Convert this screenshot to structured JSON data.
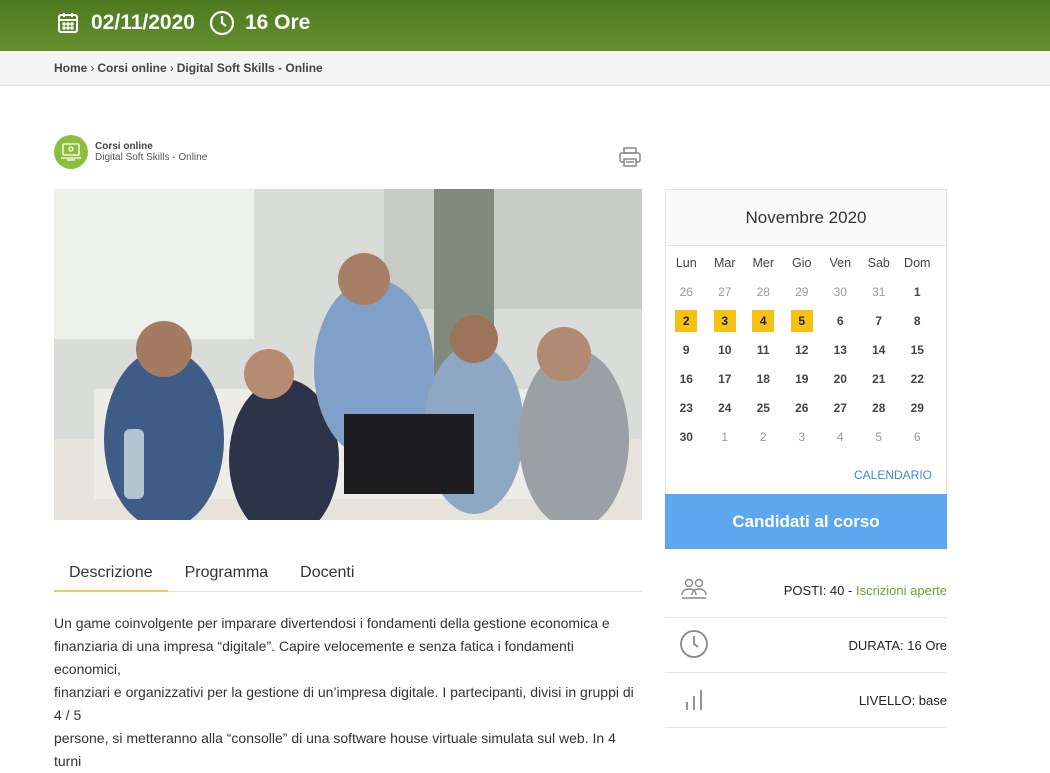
{
  "topbar": {
    "date": "02/11/2020",
    "duration": "16 Ore",
    "bg": "#5a8a28"
  },
  "breadcrumb": {
    "home": "Home",
    "category": "Corsi online",
    "current": "Digital Soft Skills - Online"
  },
  "category": {
    "name": "Corsi online",
    "course": "Digital Soft Skills - Online"
  },
  "tabs": [
    {
      "label": "Descrizione"
    },
    {
      "label": "Programma"
    },
    {
      "label": "Docenti"
    }
  ],
  "description": {
    "line1": "Un game coinvolgente per imparare divertendosi i fondamenti della gestione economica e",
    "line2": "finanziaria di una impresa “digitale”. Capire velocemente e senza fatica i fondamenti economici,",
    "line3": "finanziari e organizzativi per la gestione di un’impresa digitale. I partecipanti, divisi in gruppi di 4 / 5",
    "line4": "persone, si metteranno alla “consolle” di una software house virtuale simulata sul web. In 4 turni"
  },
  "calendar": {
    "month": "Novembre 2020",
    "weekdays": [
      "Lun",
      "Mar",
      "Mer",
      "Gio",
      "Ven",
      "Sab",
      "Dom"
    ],
    "weeks": [
      [
        {
          "d": "26",
          "m": true
        },
        {
          "d": "27",
          "m": true
        },
        {
          "d": "28",
          "m": true
        },
        {
          "d": "29",
          "m": true
        },
        {
          "d": "30",
          "m": true
        },
        {
          "d": "31",
          "m": true
        },
        {
          "d": "1"
        }
      ],
      [
        {
          "d": "2",
          "h": true
        },
        {
          "d": "3",
          "h": true
        },
        {
          "d": "4",
          "h": true
        },
        {
          "d": "5",
          "h": true
        },
        {
          "d": "6"
        },
        {
          "d": "7"
        },
        {
          "d": "8"
        }
      ],
      [
        {
          "d": "9"
        },
        {
          "d": "10"
        },
        {
          "d": "11"
        },
        {
          "d": "12"
        },
        {
          "d": "13"
        },
        {
          "d": "14"
        },
        {
          "d": "15"
        }
      ],
      [
        {
          "d": "16"
        },
        {
          "d": "17"
        },
        {
          "d": "18"
        },
        {
          "d": "19"
        },
        {
          "d": "20"
        },
        {
          "d": "21"
        },
        {
          "d": "22"
        }
      ],
      [
        {
          "d": "23"
        },
        {
          "d": "24"
        },
        {
          "d": "25"
        },
        {
          "d": "26"
        },
        {
          "d": "27"
        },
        {
          "d": "28"
        },
        {
          "d": "29"
        }
      ],
      [
        {
          "d": "30"
        },
        {
          "d": "1",
          "m": true
        },
        {
          "d": "2",
          "m": true
        },
        {
          "d": "3",
          "m": true
        },
        {
          "d": "4",
          "m": true
        },
        {
          "d": "5",
          "m": true
        },
        {
          "d": "6",
          "m": true
        }
      ]
    ],
    "link": "CALENDARIO",
    "highlight_color": "#f5c213"
  },
  "apply_label": "Candidati al corso",
  "info": {
    "posti_label": "POSTI: 40 -",
    "posti_status": "Iscrizioni aperte",
    "durata": "DURATA: 16 Ore",
    "livello": "LIVELLO: base"
  }
}
